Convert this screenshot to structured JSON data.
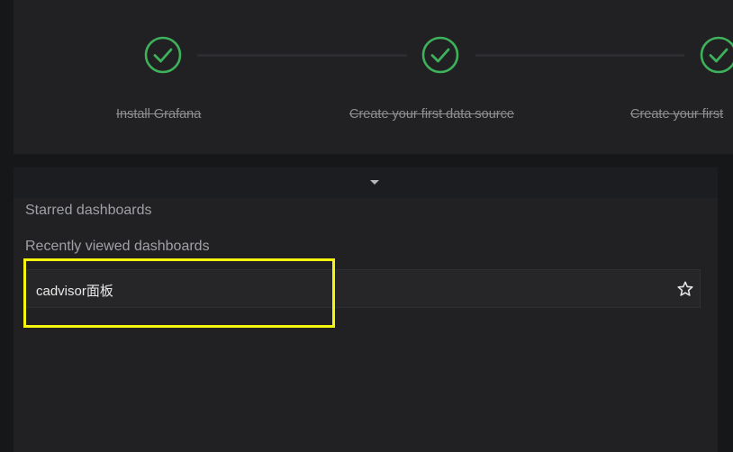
{
  "steps": [
    {
      "label": "Install Grafana",
      "completed": true,
      "icon": "check-circle-icon"
    },
    {
      "label": "Create your first data source",
      "completed": true,
      "icon": "check-circle-icon"
    },
    {
      "label": "Create your first",
      "completed": true,
      "icon": "check-circle-icon"
    }
  ],
  "dashboards": {
    "starred_title": "Starred dashboards",
    "recent_title": "Recently viewed dashboards",
    "recent_items": [
      {
        "label": "cadvisor面板",
        "icon": "star-outline-icon"
      }
    ]
  },
  "colors": {
    "success": "#3eb15b",
    "panel_bg": "#212124",
    "highlight": "#f5f60e"
  }
}
